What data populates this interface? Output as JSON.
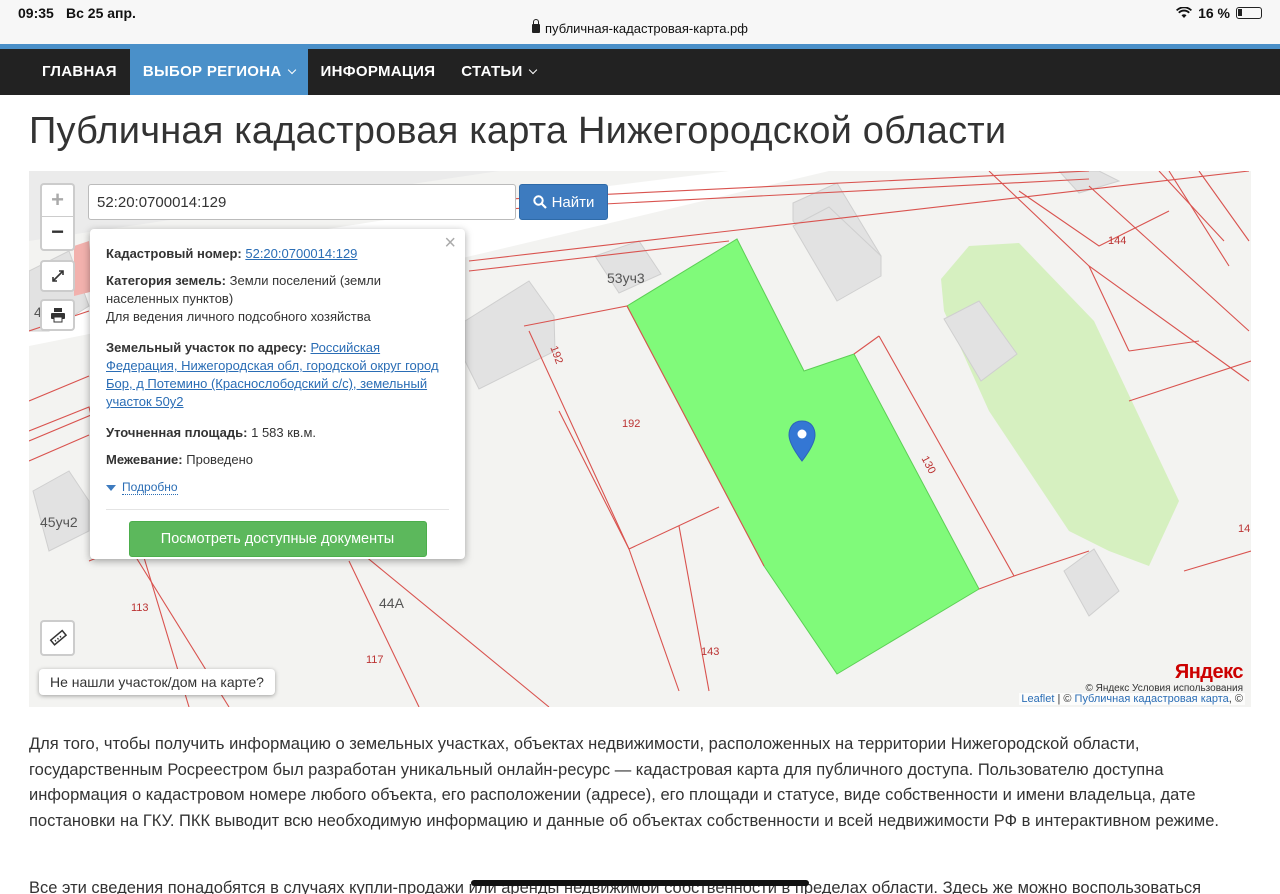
{
  "status_bar": {
    "time": "09:35",
    "date": "Вс 25 апр.",
    "url": "публичная-кадастровая-карта.рф",
    "battery": "16 %"
  },
  "nav": {
    "items": [
      {
        "label": "ГЛАВНАЯ",
        "active": false
      },
      {
        "label": "ВЫБОР РЕГИОНА",
        "active": true,
        "dropdown": true
      },
      {
        "label": "ИНФОРМАЦИЯ",
        "active": false
      },
      {
        "label": "СТАТЬИ",
        "active": false,
        "dropdown": true
      }
    ]
  },
  "page_title": "Публичная кадастровая карта Нижегородской области",
  "map": {
    "zoom_in": "+",
    "zoom_out": "−",
    "search_value": "52:20:0700014:129",
    "search_button": "Найти",
    "popup": {
      "cad_label": "Кадастровый номер:",
      "cad_value": "52:20:0700014:129",
      "category_label": "Категория земель:",
      "category_value": "Земли поселений (земли населенных пунктов)",
      "usage": "Для ведения личного подсобного хозяйства",
      "address_label": "Земельный участок по адресу:",
      "address_value": "Российская Федерация, Нижегородская обл, городской округ город Бор, д Потемино (Краснослободский с/с), земельный участок 50у2",
      "area_label": "Уточненная площадь:",
      "area_value": "1 583 кв.м.",
      "survey_label": "Межевание:",
      "survey_value": "Проведено",
      "more": "Подробно",
      "docs_button": "Посмотреть доступные документы",
      "close": "×"
    },
    "labels": {
      "l1": "53уч3",
      "l2": "192",
      "l3": "192",
      "l4": "130",
      "l5": "144",
      "l6": "143",
      "l7": "44А",
      "l8": "113",
      "l9": "117",
      "l10": "45уч2",
      "l11": "14",
      "l12": "4"
    },
    "not_found": "Не нашли участок/дом на карте?",
    "yandex_logo": "Яндекс",
    "yandex_terms": "© Яндекс  Условия использования",
    "attribution_leaflet": "Leaflet",
    "attribution_sep": " | © ",
    "attribution_pkk": "Публичная кадастровая карта",
    "attribution_end": ", ©"
  },
  "body_text": "Для того, чтобы получить информацию о земельных участках, объектах недвижимости, расположенных на территории Нижегородской области, государственным Росреестром был разработан уникальный онлайн-ресурс — кадастровая карта для публичного доступа. Пользователю доступна информация о кадастровом номере любого объекта, его расположении (адресе), его площади и статусе, виде собственности и имени владельца, дате постановки на ГКУ. ПКК выводит всю необходимую информацию и данные об объектах собственности и всей недвижимости РФ в интерактивном режиме.",
  "body_text2": "Все эти сведения понадобятся в случаях купли-продажи или аренды недвижимой собственности в пределах области. Здесь же можно воспользоваться",
  "colors": {
    "accent": "#4a90c9",
    "nav_bg": "#222222",
    "parcel": "#80fa7a",
    "button_green": "#5cb85c",
    "cad_line": "#d9534f"
  }
}
